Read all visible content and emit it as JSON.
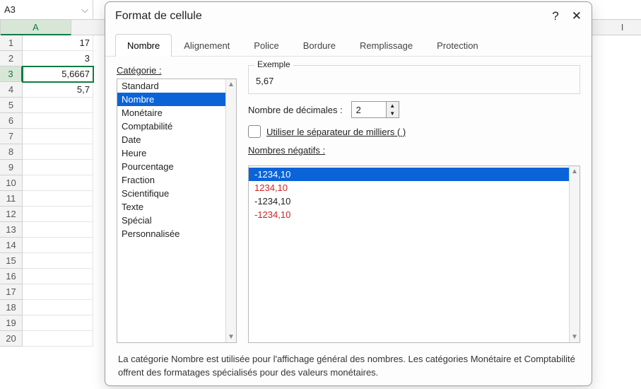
{
  "namebox": "A3",
  "columns": [
    "A",
    "I"
  ],
  "rows": [
    {
      "n": "1",
      "v": "17"
    },
    {
      "n": "2",
      "v": "3"
    },
    {
      "n": "3",
      "v": "5,6667",
      "sel": true
    },
    {
      "n": "4",
      "v": "5,7"
    },
    {
      "n": "5",
      "v": ""
    },
    {
      "n": "6",
      "v": ""
    },
    {
      "n": "7",
      "v": ""
    },
    {
      "n": "8",
      "v": ""
    },
    {
      "n": "9",
      "v": ""
    },
    {
      "n": "10",
      "v": ""
    },
    {
      "n": "11",
      "v": ""
    },
    {
      "n": "12",
      "v": ""
    },
    {
      "n": "13",
      "v": ""
    },
    {
      "n": "14",
      "v": ""
    },
    {
      "n": "15",
      "v": ""
    },
    {
      "n": "16",
      "v": ""
    },
    {
      "n": "17",
      "v": ""
    },
    {
      "n": "18",
      "v": ""
    },
    {
      "n": "19",
      "v": ""
    },
    {
      "n": "20",
      "v": ""
    }
  ],
  "dialog": {
    "title": "Format de cellule",
    "help": "?",
    "tabs": [
      "Nombre",
      "Alignement",
      "Police",
      "Bordure",
      "Remplissage",
      "Protection"
    ],
    "category_label": "Catégorie :",
    "categories": [
      "Standard",
      "Nombre",
      "Monétaire",
      "Comptabilité",
      "Date",
      "Heure",
      "Pourcentage",
      "Fraction",
      "Scientifique",
      "Texte",
      "Spécial",
      "Personnalisée"
    ],
    "example_label": "Exemple",
    "example_value": "5,67",
    "decimals_label": "Nombre de décimales :",
    "decimals_value": "2",
    "thousands_label": "Utiliser le séparateur de milliers ( )",
    "neg_label": "Nombres négatifs :",
    "neg_items": [
      {
        "t": "-1234,10",
        "sel": true
      },
      {
        "t": "1234,10",
        "red": true
      },
      {
        "t": "-1234,10"
      },
      {
        "t": "-1234,10",
        "red": true
      }
    ],
    "desc": "La catégorie Nombre est utilisée pour l'affichage général des nombres. Les catégories Monétaire et Comptabilité offrent des formatages spécialisés pour des valeurs monétaires."
  }
}
